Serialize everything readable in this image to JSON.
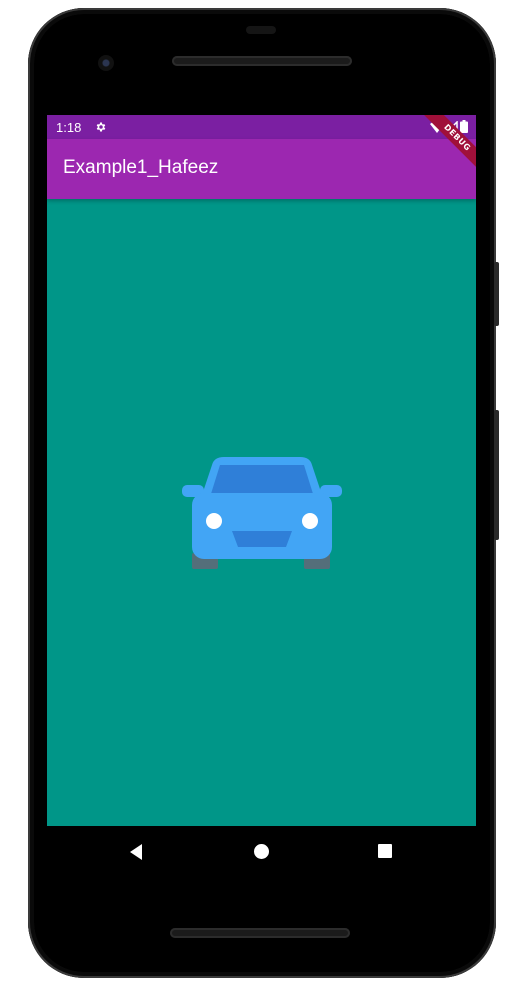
{
  "status_bar": {
    "time": "1:18",
    "settings_icon": "gear-icon",
    "wifi_icon": "wifi-icon",
    "signal_icon": "cell-signal-icon",
    "battery_icon": "battery-icon",
    "color": "#7b1fa2"
  },
  "app_bar": {
    "title": "Example1_Hafeez",
    "color": "#9c27b0"
  },
  "debug_banner": {
    "label": "DEBUG",
    "color": "#a0103a"
  },
  "body": {
    "background": "#009688",
    "icon": "car-icon",
    "icon_color": "#42a5f5"
  },
  "nav_bar": {
    "back_icon": "back-triangle-icon",
    "home_icon": "home-circle-icon",
    "recents_icon": "recents-square-icon"
  }
}
